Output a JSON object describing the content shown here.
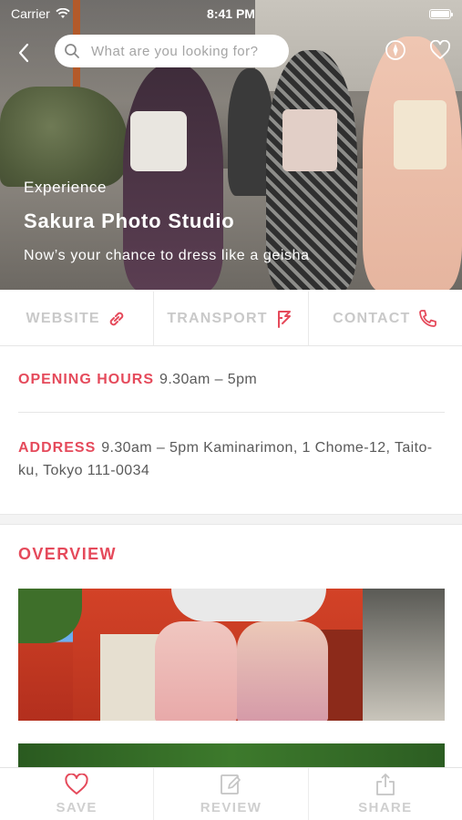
{
  "status_bar": {
    "carrier": "Carrier",
    "time": "8:41 PM"
  },
  "search": {
    "placeholder": "What are you looking for?"
  },
  "hero": {
    "category": "Experience",
    "title": "Sakura Photo Studio",
    "subtitle": "Now’s your chance to dress like a geisha"
  },
  "actions": [
    {
      "label": "WEBSITE",
      "icon": "link-icon"
    },
    {
      "label": "TRANSPORT",
      "icon": "transport-icon"
    },
    {
      "label": "CONTACT",
      "icon": "phone-icon"
    }
  ],
  "info": {
    "hours_label": "OPENING HOURS",
    "hours_value": "9.30am – 5pm",
    "address_label": "ADDRESS",
    "address_value": "9.30am – 5pm Kaminarimon, 1 Chome-12, Taito-ku, Tokyo 111-0034"
  },
  "overview": {
    "title": "OVERVIEW"
  },
  "tabbar": [
    {
      "label": "SAVE",
      "icon": "heart-icon"
    },
    {
      "label": "REVIEW",
      "icon": "review-icon"
    },
    {
      "label": "SHARE",
      "icon": "share-icon"
    }
  ],
  "colors": {
    "accent": "#e54a5b",
    "muted": "#c9c9c9"
  }
}
